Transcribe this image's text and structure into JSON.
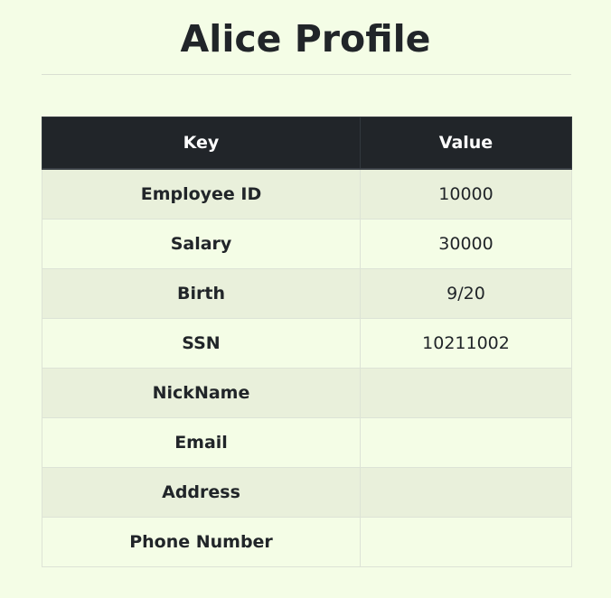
{
  "page": {
    "title": "Alice Profile"
  },
  "table": {
    "headers": {
      "key": "Key",
      "value": "Value"
    },
    "rows": [
      {
        "key": "Employee ID",
        "value": "10000"
      },
      {
        "key": "Salary",
        "value": "30000"
      },
      {
        "key": "Birth",
        "value": "9/20"
      },
      {
        "key": "SSN",
        "value": "10211002"
      },
      {
        "key": "NickName",
        "value": ""
      },
      {
        "key": "Email",
        "value": ""
      },
      {
        "key": "Address",
        "value": ""
      },
      {
        "key": "Phone Number",
        "value": ""
      }
    ]
  },
  "colors": {
    "background": "#f4fde6",
    "header_bg": "#212529",
    "striped_row": "#e9f0db"
  }
}
